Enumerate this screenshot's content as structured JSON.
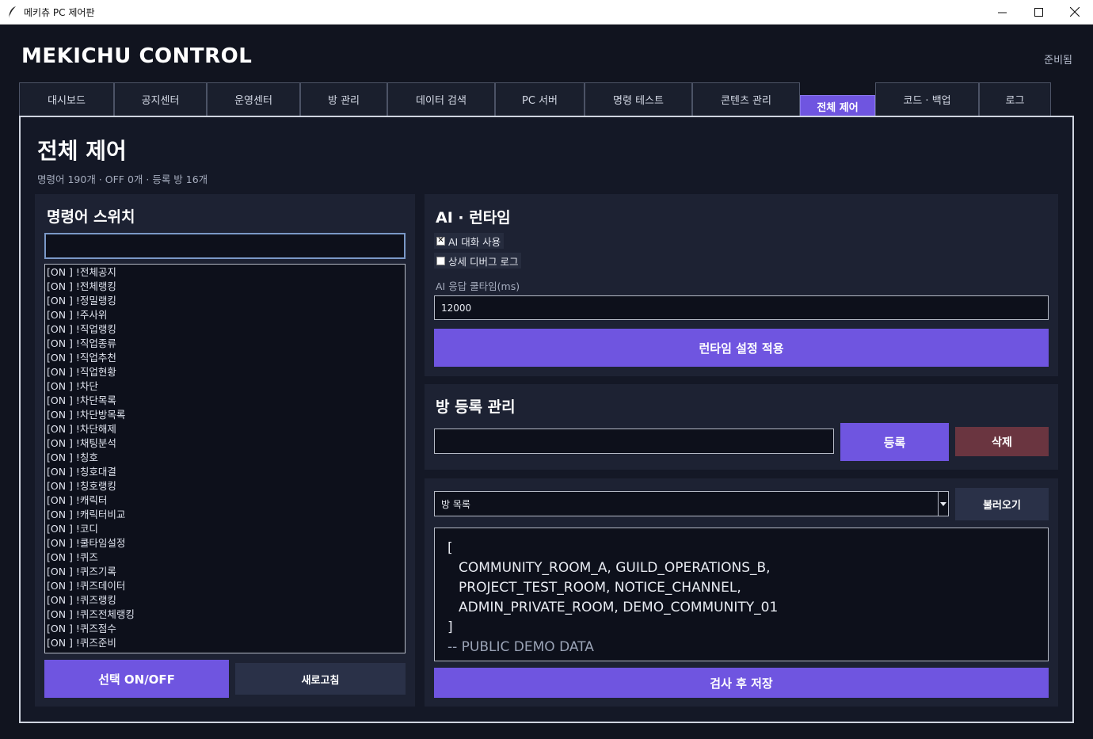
{
  "window": {
    "title": "메키츄 PC 제어판"
  },
  "app": {
    "title": "MEKICHU CONTROL",
    "status": "준비됨"
  },
  "tabs": [
    {
      "label": "대시보드"
    },
    {
      "label": "공지센터"
    },
    {
      "label": "운영센터"
    },
    {
      "label": "방 관리"
    },
    {
      "label": "데이터 검색"
    },
    {
      "label": "PC 서버"
    },
    {
      "label": "명령 테스트"
    },
    {
      "label": "콘텐츠 관리"
    },
    {
      "label": "전체 제어"
    },
    {
      "label": "코드 · 백업"
    },
    {
      "label": "로그"
    }
  ],
  "active_tab": "전체 제어",
  "page": {
    "title": "전체 제어",
    "subtitle": "명령어 190개 · OFF 0개 · 등록 방 16개"
  },
  "commands": {
    "title": "명령어 스위치",
    "search_value": "",
    "items": [
      "[ON ] !전체공지",
      "[ON ] !전체랭킹",
      "[ON ] !정밀랭킹",
      "[ON ] !주사위",
      "[ON ] !직업랭킹",
      "[ON ] !직업종류",
      "[ON ] !직업추천",
      "[ON ] !직업현황",
      "[ON ] !차단",
      "[ON ] !차단목록",
      "[ON ] !차단방목록",
      "[ON ] !차단해제",
      "[ON ] !채팅분석",
      "[ON ] !칭호",
      "[ON ] !칭호대결",
      "[ON ] !칭호랭킹",
      "[ON ] !캐릭터",
      "[ON ] !캐릭터비교",
      "[ON ] !코디",
      "[ON ] !쿨타임설정",
      "[ON ] !퀴즈",
      "[ON ] !퀴즈기록",
      "[ON ] !퀴즈데이터",
      "[ON ] !퀴즈랭킹",
      "[ON ] !퀴즈전체랭킹",
      "[ON ] !퀴즈점수",
      "[ON ] !퀴즈준비"
    ],
    "toggle_label": "선택 ON/OFF",
    "refresh_label": "새로고침"
  },
  "runtime": {
    "title": "AI · 런타임",
    "ai_chat": {
      "label": "AI 대화 사용",
      "checked": true
    },
    "debug_log": {
      "label": "상세 디버그 로그",
      "checked": false
    },
    "cooldown_label": "AI 응답 쿨타임(ms)",
    "cooldown_value": "12000",
    "apply_label": "런타임 설정 적용"
  },
  "rooms": {
    "title": "방 등록 관리",
    "input_value": "",
    "register_label": "등록",
    "delete_label": "삭제",
    "select_value": "방 목록",
    "load_label": "불러오기",
    "code_lines": [
      "[",
      "COMMUNITY_ROOM_A,   GUILD_OPERATIONS_B,",
      "PROJECT_TEST_ROOM, NOTICE_CHANNEL,",
      "ADMIN_PRIVATE_ROOM, DEMO_COMMUNITY_01",
      "]",
      "-- PUBLIC DEMO DATA"
    ],
    "save_label": "검사 후 저장"
  },
  "icons": {
    "app": "feather-icon",
    "minimize": "minimize-icon",
    "maximize": "maximize-icon",
    "close": "close-icon",
    "dropdown": "chevron-down-icon"
  },
  "colors": {
    "accent": "#6f55e0",
    "danger": "#6a3540",
    "background": "#11141f",
    "card": "#1d2233"
  }
}
